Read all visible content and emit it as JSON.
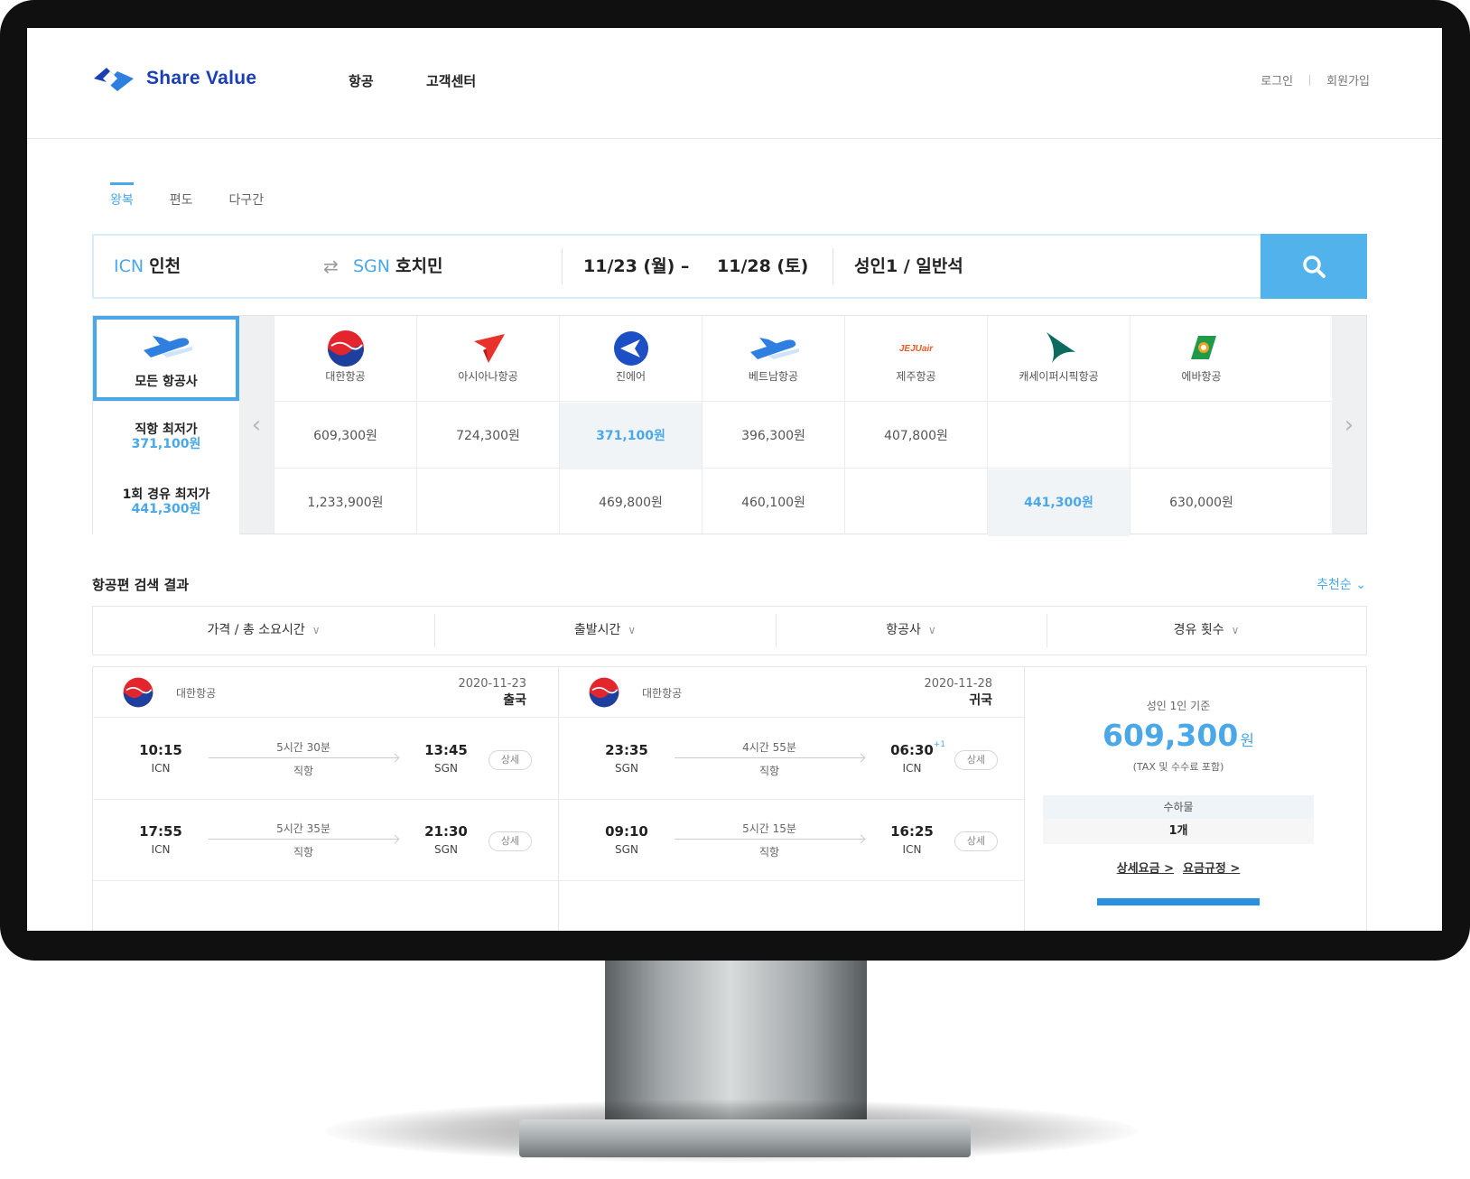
{
  "header": {
    "brand": "Share Value",
    "nav": [
      "항공",
      "고객센터"
    ],
    "login": "로그인",
    "signup": "회원가입"
  },
  "trip_tabs": [
    "왕복",
    "편도",
    "다구간"
  ],
  "search": {
    "origin_code": "ICN",
    "origin_city": "인천",
    "dest_code": "SGN",
    "dest_city": "호치민",
    "depart_date": "11/23 (월) –",
    "return_date": "11/28 (토)",
    "passengers": "성인1 / 일반석"
  },
  "airline_matrix": {
    "all_label": "모든 항공사",
    "direct_label": "직항 최저가",
    "direct_min": "371,100원",
    "one_stop_label": "1회 경유 최저가",
    "one_stop_min": "441,300원",
    "airlines": [
      {
        "name": "대한항공",
        "icon": "korean-air-icon",
        "direct": "609,300원",
        "one_stop": "1,233,900원"
      },
      {
        "name": "아시아나항공",
        "icon": "asiana-icon",
        "direct": "724,300원",
        "one_stop": ""
      },
      {
        "name": "진에어",
        "icon": "jinair-icon",
        "direct": "371,100원",
        "one_stop": "469,800원"
      },
      {
        "name": "베트남항공",
        "icon": "vietnam-airlines-icon",
        "direct": "396,300원",
        "one_stop": "460,100원"
      },
      {
        "name": "제주항공",
        "icon": "jejuair-icon",
        "direct": "407,800원",
        "one_stop": ""
      },
      {
        "name": "캐세이퍼시픽항공",
        "icon": "cathay-pacific-icon",
        "direct": "",
        "one_stop": "441,300원"
      },
      {
        "name": "에바항공",
        "icon": "eva-air-icon",
        "direct": "",
        "one_stop": "630,000원"
      }
    ],
    "jeju_logo_text": "JEJUair"
  },
  "results": {
    "title": "항공편 검색 결과",
    "sort": "추천순",
    "filters": [
      "가격 / 총 소요시간",
      "출발시간",
      "항공사",
      "경유 횟수"
    ],
    "card": {
      "outbound": {
        "airline": "대한항공",
        "date": "2020-11-23",
        "direction": "출국",
        "flights": [
          {
            "dep_time": "10:15",
            "dep_ap": "ICN",
            "duration": "5시간 30분",
            "stops": "직항",
            "arr_time": "13:45",
            "arr_ap": "SGN",
            "next_day": "",
            "detail": "상세"
          },
          {
            "dep_time": "17:55",
            "dep_ap": "ICN",
            "duration": "5시간 35분",
            "stops": "직항",
            "arr_time": "21:30",
            "arr_ap": "SGN",
            "next_day": "",
            "detail": "상세"
          }
        ]
      },
      "inbound": {
        "airline": "대한항공",
        "date": "2020-11-28",
        "direction": "귀국",
        "flights": [
          {
            "dep_time": "23:35",
            "dep_ap": "SGN",
            "duration": "4시간 55분",
            "stops": "직항",
            "arr_time": "06:30",
            "arr_ap": "ICN",
            "next_day": "+1",
            "detail": "상세"
          },
          {
            "dep_time": "09:10",
            "dep_ap": "SGN",
            "duration": "5시간 15분",
            "stops": "직항",
            "arr_time": "16:25",
            "arr_ap": "ICN",
            "next_day": "",
            "detail": "상세"
          }
        ]
      },
      "price": {
        "basis": "성인 1인 기준",
        "amount": "609,300",
        "currency": "원",
        "tax_note": "(TAX 및 수수료 포함)",
        "baggage_label": "수하물",
        "baggage_value": "1개",
        "link_fare_detail": "상세요금 >",
        "link_fare_rules": "요금규정 >"
      }
    }
  },
  "colors": {
    "accent": "#4aa8e8",
    "search_button": "#52b3ec",
    "brand": "#1a3fb5"
  }
}
